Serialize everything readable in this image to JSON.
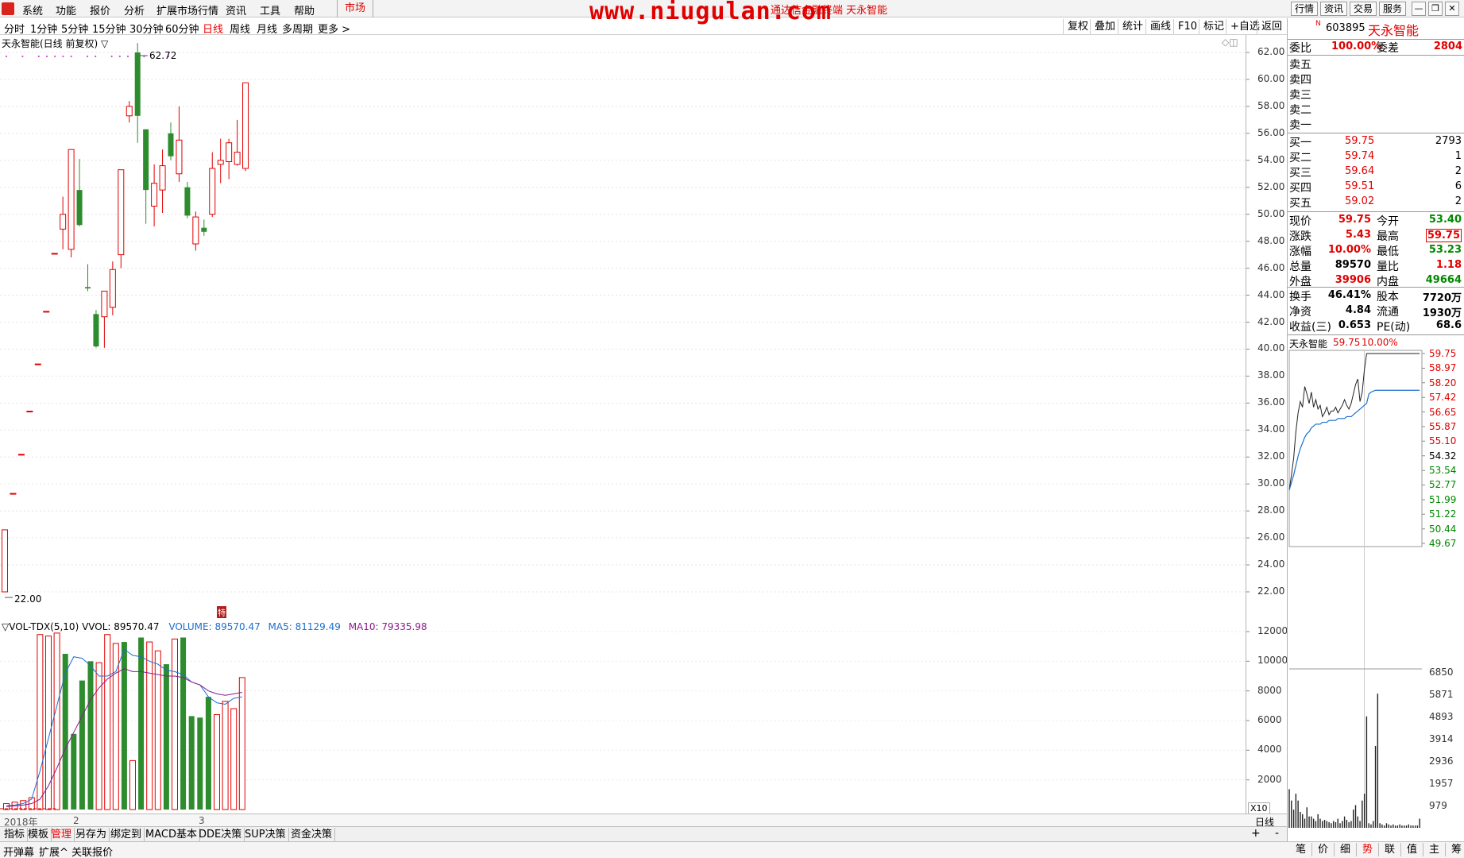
{
  "menu": {
    "items": [
      "系统",
      "功能",
      "报价",
      "分析",
      "扩展市场行情",
      "资讯",
      "工具",
      "帮助"
    ],
    "market_label": "市场",
    "watermark": "www.niugulan.com",
    "watermark_sub": "通达信金融终端 天永智能",
    "right_buttons": [
      "行情",
      "资讯",
      "交易",
      "服务"
    ]
  },
  "periods": {
    "items": [
      "分时",
      "1分钟",
      "5分钟",
      "15分钟",
      "30分钟",
      "60分钟",
      "日线",
      "周线",
      "月线",
      "多周期",
      "更多 >"
    ],
    "active": "日线"
  },
  "toolbar": [
    "复权",
    "叠加",
    "统计",
    "画线",
    "F10",
    "标记",
    "+自选",
    "返回"
  ],
  "kline": {
    "title": "天永智能(日线 前复权) ▽",
    "high_label": "62.72",
    "low_label": "22.00",
    "marker_label": "特",
    "axis": [
      "62.00",
      "60.00",
      "58.00",
      "56.00",
      "54.00",
      "52.00",
      "50.00",
      "48.00",
      "46.00",
      "44.00",
      "42.00",
      "40.00",
      "38.00",
      "36.00",
      "34.00",
      "32.00",
      "30.00",
      "28.00",
      "26.00",
      "24.00",
      "22.00"
    ]
  },
  "volume": {
    "title": "▽VOL-TDX(5,10) VVOL: 89570.47",
    "volume_label": "VOLUME: 89570.47",
    "ma5_label": "MA5: 81129.49",
    "ma10_label": "MA10: 79335.98",
    "axis": [
      "12000",
      "10000",
      "8000",
      "6000",
      "4000",
      "2000"
    ],
    "axis_unit": "X10"
  },
  "datebar": {
    "year": "2018年",
    "month1": "2",
    "month2": "3",
    "right": "日线"
  },
  "bottom_tabs": [
    "指标",
    "模板",
    "管理",
    "另存为",
    "绑定到",
    "MACD基本",
    "DDE决策",
    "SUP决策",
    "资金决策"
  ],
  "bottom_tabs_active": "管理",
  "status_items": [
    "开弹幕",
    "扩展^",
    "关联报价"
  ],
  "quote": {
    "prefix": "N",
    "code": "603895",
    "name": "天永智能",
    "weibi_label": "委比",
    "weibi_value": "100.00%",
    "weicha_label": "委差",
    "weicha_value": "2804",
    "sell": [
      {
        "label": "卖五",
        "price": "",
        "vol": ""
      },
      {
        "label": "卖四",
        "price": "",
        "vol": ""
      },
      {
        "label": "卖三",
        "price": "",
        "vol": ""
      },
      {
        "label": "卖二",
        "price": "",
        "vol": ""
      },
      {
        "label": "卖一",
        "price": "",
        "vol": ""
      }
    ],
    "buy": [
      {
        "label": "买一",
        "price": "59.75",
        "vol": "2793"
      },
      {
        "label": "买二",
        "price": "59.74",
        "vol": "1"
      },
      {
        "label": "买三",
        "price": "59.64",
        "vol": "2"
      },
      {
        "label": "买四",
        "price": "59.51",
        "vol": "6"
      },
      {
        "label": "买五",
        "price": "59.02",
        "vol": "2"
      }
    ],
    "stats": [
      {
        "l1": "现价",
        "v1": "59.75",
        "c1": "red",
        "l2": "今开",
        "v2": "53.40",
        "c2": "green"
      },
      {
        "l1": "涨跌",
        "v1": "5.43",
        "c1": "red",
        "l2": "最高",
        "v2": "59.75",
        "c2": "red"
      },
      {
        "l1": "涨幅",
        "v1": "10.00%",
        "c1": "red",
        "l2": "最低",
        "v2": "53.23",
        "c2": "green"
      },
      {
        "l1": "总量",
        "v1": "89570",
        "c1": "black",
        "l2": "量比",
        "v2": "1.18",
        "c2": "red"
      },
      {
        "l1": "外盘",
        "v1": "39906",
        "c1": "red",
        "l2": "内盘",
        "v2": "49664",
        "c2": "green"
      }
    ],
    "stats2": [
      {
        "l1": "换手",
        "v1": "46.41%",
        "l2": "股本",
        "v2": "7720万"
      },
      {
        "l1": "净资",
        "v1": "4.84",
        "l2": "流通",
        "v2": "1930万"
      },
      {
        "l1": "收益(三)",
        "v1": "0.653",
        "l2": "PE(动)",
        "v2": "68.6"
      }
    ]
  },
  "mini": {
    "name": "天永智能",
    "price": "59.75",
    "change": "10.00%",
    "price_axis": [
      {
        "v": "59.75",
        "c": "red"
      },
      {
        "v": "58.97",
        "c": "red"
      },
      {
        "v": "58.20",
        "c": "red"
      },
      {
        "v": "57.42",
        "c": "red"
      },
      {
        "v": "56.65",
        "c": "red"
      },
      {
        "v": "55.87",
        "c": "red"
      },
      {
        "v": "55.10",
        "c": "red"
      },
      {
        "v": "54.32",
        "c": "black"
      },
      {
        "v": "53.54",
        "c": "green"
      },
      {
        "v": "52.77",
        "c": "green"
      },
      {
        "v": "51.99",
        "c": "green"
      },
      {
        "v": "51.22",
        "c": "green"
      },
      {
        "v": "50.44",
        "c": "green"
      },
      {
        "v": "49.67",
        "c": "green"
      }
    ],
    "vol_axis": [
      "6850",
      "5871",
      "4893",
      "3914",
      "2936",
      "1957",
      "979"
    ]
  },
  "right_tabs": [
    "笔",
    "价",
    "细",
    "势",
    "联",
    "值",
    "主",
    "筹"
  ],
  "right_tabs_active": "势",
  "colors": {
    "up": "#e10000",
    "down": "#2d8c2d",
    "ma5": "#1a6fd1",
    "ma10": "#8b1a8b"
  },
  "chart_data": {
    "type": "candlestick",
    "title": "天永智能(日线 前复权)",
    "ylim": [
      21,
      63
    ],
    "candles": [
      {
        "o": 22.0,
        "h": 26.6,
        "l": 22.0,
        "c": 26.6
      },
      {
        "o": 29.3,
        "h": 29.3,
        "l": 29.3,
        "c": 29.3
      },
      {
        "o": 32.2,
        "h": 32.2,
        "l": 32.2,
        "c": 32.2
      },
      {
        "o": 35.4,
        "h": 35.4,
        "l": 35.4,
        "c": 35.4
      },
      {
        "o": 38.9,
        "h": 38.9,
        "l": 38.9,
        "c": 38.9
      },
      {
        "o": 42.8,
        "h": 42.8,
        "l": 42.8,
        "c": 42.8
      },
      {
        "o": 47.1,
        "h": 47.1,
        "l": 47.1,
        "c": 47.1
      },
      {
        "o": 48.9,
        "h": 51.3,
        "l": 47.4,
        "c": 50.0
      },
      {
        "o": 47.4,
        "h": 54.8,
        "l": 46.8,
        "c": 54.8
      },
      {
        "o": 51.8,
        "h": 54.1,
        "l": 49.1,
        "c": 49.2
      },
      {
        "o": 44.6,
        "h": 46.3,
        "l": 44.3,
        "c": 44.5
      },
      {
        "o": 42.6,
        "h": 42.9,
        "l": 40.1,
        "c": 40.2
      },
      {
        "o": 42.4,
        "h": 44.3,
        "l": 40.1,
        "c": 44.3
      },
      {
        "o": 43.1,
        "h": 46.5,
        "l": 42.5,
        "c": 45.9
      },
      {
        "o": 47.0,
        "h": 53.3,
        "l": 46.0,
        "c": 53.3
      },
      {
        "o": 57.3,
        "h": 58.4,
        "l": 56.8,
        "c": 58.0
      },
      {
        "o": 62.0,
        "h": 62.7,
        "l": 55.3,
        "c": 57.3
      },
      {
        "o": 56.3,
        "h": 56.3,
        "l": 49.3,
        "c": 51.8
      },
      {
        "o": 50.6,
        "h": 53.7,
        "l": 49.1,
        "c": 52.3
      },
      {
        "o": 51.8,
        "h": 54.8,
        "l": 50.1,
        "c": 53.6
      },
      {
        "o": 56.0,
        "h": 56.8,
        "l": 54.0,
        "c": 54.3
      },
      {
        "o": 53.0,
        "h": 58.0,
        "l": 52.4,
        "c": 55.5
      },
      {
        "o": 52.0,
        "h": 52.4,
        "l": 49.7,
        "c": 49.9
      },
      {
        "o": 47.8,
        "h": 50.2,
        "l": 47.3,
        "c": 49.8
      },
      {
        "o": 49.0,
        "h": 49.6,
        "l": 48.4,
        "c": 48.7
      },
      {
        "o": 50.0,
        "h": 54.6,
        "l": 49.8,
        "c": 53.4
      },
      {
        "o": 53.7,
        "h": 55.6,
        "l": 52.3,
        "c": 54.0
      },
      {
        "o": 53.9,
        "h": 55.6,
        "l": 52.6,
        "c": 55.3
      },
      {
        "o": 53.7,
        "h": 57.0,
        "l": 53.6,
        "c": 54.6
      },
      {
        "o": 53.4,
        "h": 59.75,
        "l": 53.2,
        "c": 59.75
      }
    ],
    "volume": {
      "values": [
        100,
        200,
        300,
        400,
        500,
        600,
        800,
        11800,
        11700,
        11900,
        10500,
        5100,
        8700,
        10000,
        9900,
        11800,
        11200,
        11300,
        3300,
        11600,
        11300,
        10700,
        9800,
        11500,
        11600,
        6300,
        6200,
        7600,
        6400,
        7300,
        6800,
        8900
      ],
      "dir": [
        "u",
        "u",
        "u",
        "u",
        "u",
        "u",
        "u",
        "u",
        "u",
        "u",
        "d",
        "d",
        "d",
        "d",
        "u",
        "u",
        "u",
        "d",
        "u",
        "d",
        "u",
        "u",
        "d",
        "u",
        "d",
        "d",
        "d",
        "d",
        "u",
        "u",
        "u",
        "u"
      ],
      "ma5": [
        100,
        150,
        200,
        250,
        300,
        400,
        700,
        2600,
        4800,
        7000,
        9200,
        10300,
        10200,
        9700,
        9000,
        9000,
        9300,
        10800,
        10400,
        10300,
        10000,
        9800,
        9400,
        9300,
        9100,
        8600,
        8400,
        7600,
        7200,
        7100,
        7500,
        7600
      ],
      "ma10": [
        100,
        100,
        150,
        200,
        250,
        300,
        400,
        700,
        1600,
        2800,
        4100,
        5200,
        6300,
        7400,
        8200,
        8800,
        9200,
        9500,
        9300,
        9300,
        9200,
        9100,
        9000,
        9000,
        8900,
        8600,
        8400,
        8000,
        7800,
        7700,
        7800,
        7900
      ]
    },
    "intraday": {
      "price_ylim": [
        49.67,
        59.75
      ],
      "price": [
        52.5,
        53.3,
        54.2,
        55.6,
        56.6,
        57.2,
        56.9,
        58.0,
        57.6,
        57.1,
        57.7,
        56.9,
        57.3,
        56.8,
        57.0,
        56.4,
        56.6,
        56.9,
        56.5,
        56.7,
        56.7,
        56.9,
        56.6,
        56.8,
        57.0,
        57.3,
        57.0,
        56.8,
        57.1,
        57.6,
        58.1,
        58.4,
        57.2,
        57.7,
        58.9,
        59.75,
        59.75,
        59.75,
        59.75,
        59.75,
        59.75,
        59.75,
        59.75,
        59.75,
        59.75,
        59.75,
        59.75,
        59.75,
        59.75,
        59.75,
        59.75,
        59.75,
        59.75,
        59.75,
        59.75,
        59.75,
        59.75,
        59.75,
        59.75,
        59.75
      ],
      "avg": [
        52.5,
        52.9,
        53.3,
        53.8,
        54.3,
        54.7,
        55.0,
        55.3,
        55.5,
        55.6,
        55.8,
        55.9,
        56.0,
        56.0,
        56.0,
        56.1,
        56.1,
        56.1,
        56.2,
        56.2,
        56.2,
        56.2,
        56.3,
        56.3,
        56.3,
        56.3,
        56.4,
        56.4,
        56.4,
        56.5,
        56.6,
        56.7,
        56.8,
        56.9,
        57.0,
        57.1,
        57.6,
        57.7,
        57.75,
        57.8,
        57.8,
        57.8,
        57.8,
        57.8,
        57.8,
        57.8,
        57.8,
        57.8,
        57.8,
        57.8,
        57.8,
        57.8,
        57.8,
        57.8,
        57.8,
        57.8,
        57.8,
        57.8,
        57.8,
        57.8
      ],
      "vol_ylim": [
        0,
        6850
      ],
      "vols": [
        1700,
        1200,
        800,
        1500,
        1200,
        700,
        600,
        400,
        900,
        500,
        500,
        400,
        300,
        600,
        400,
        300,
        350,
        300,
        250,
        200,
        300,
        250,
        400,
        200,
        300,
        500,
        350,
        250,
        300,
        800,
        1000,
        500,
        300,
        1200,
        1500,
        4900,
        200,
        150,
        300,
        3600,
        5900,
        200,
        150,
        100,
        200,
        150,
        100,
        150,
        100,
        100,
        150,
        100,
        100,
        100,
        150,
        100,
        100,
        100,
        100,
        400
      ]
    }
  }
}
